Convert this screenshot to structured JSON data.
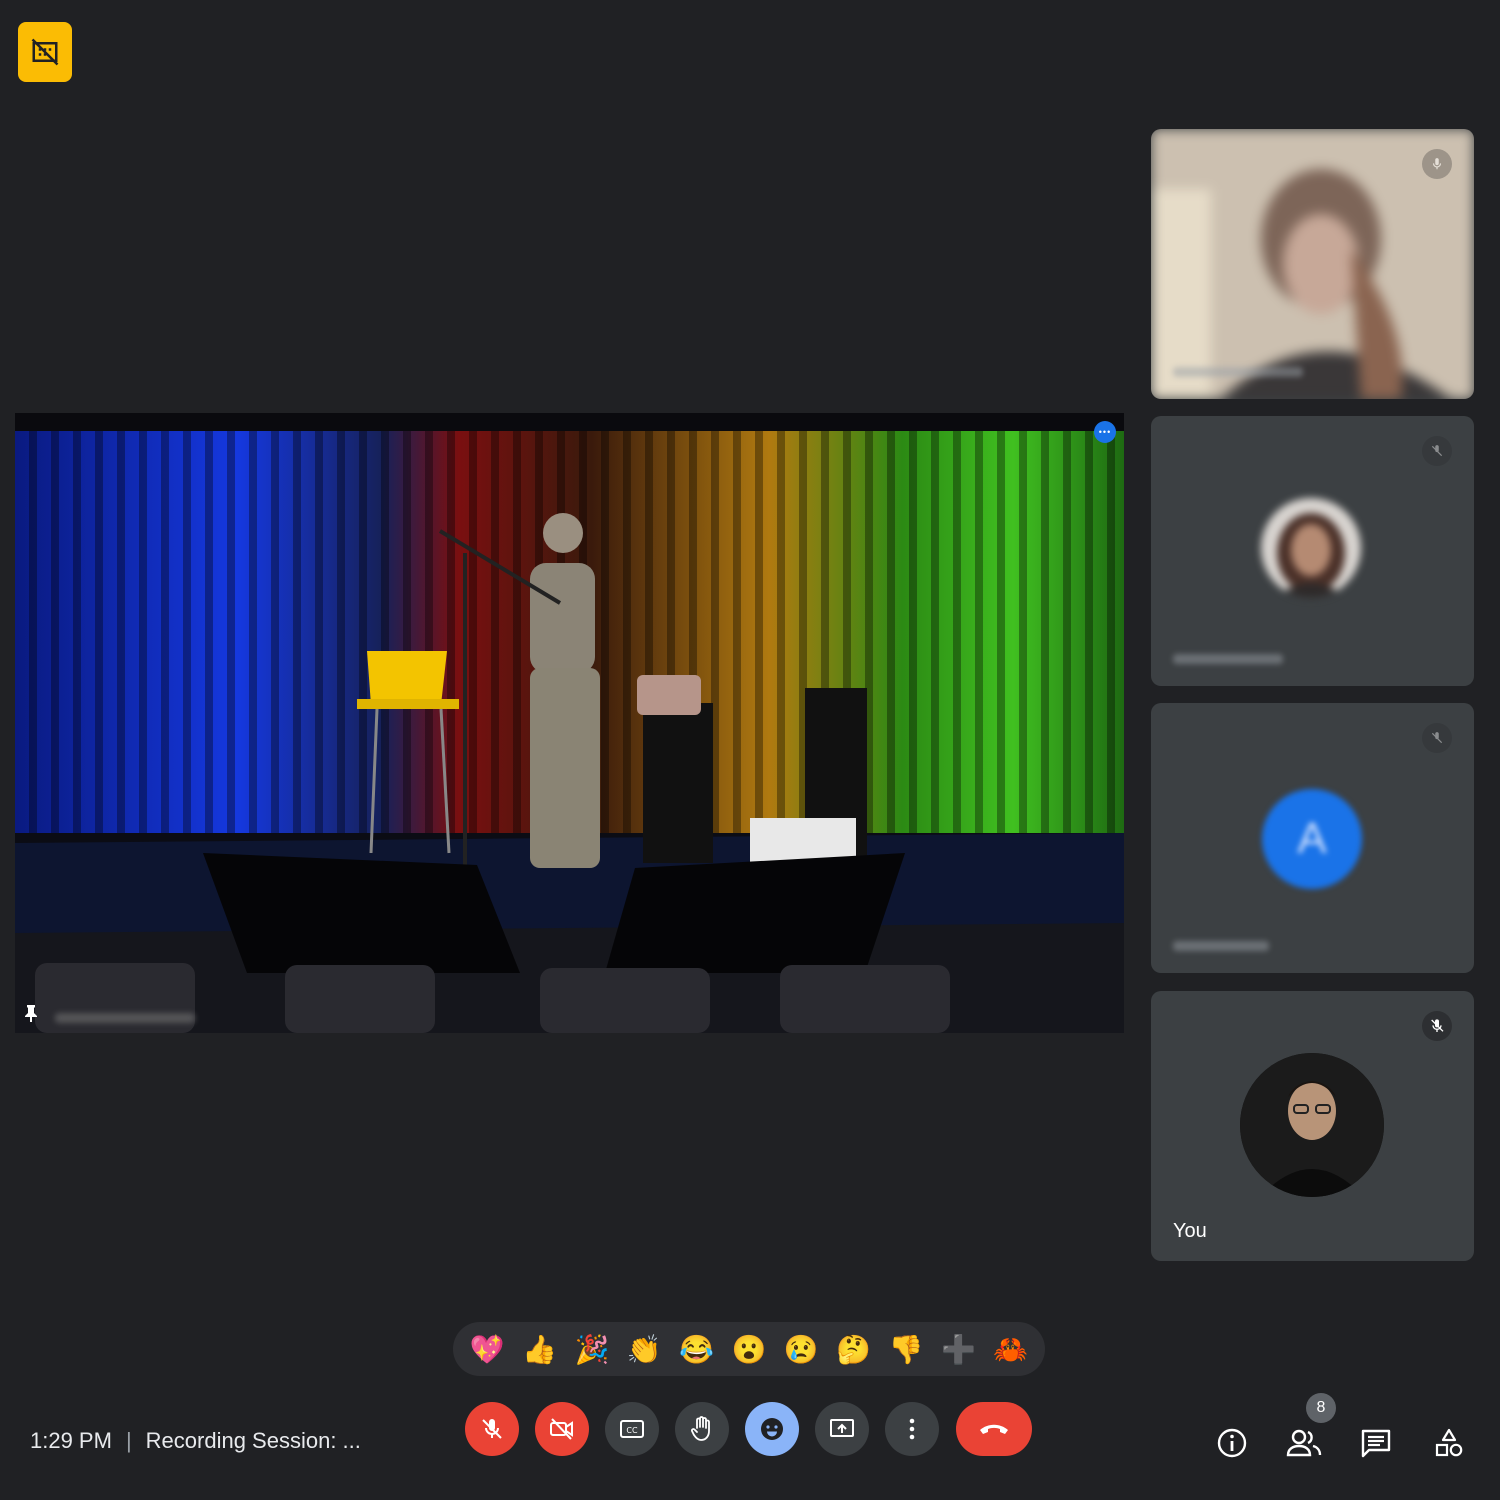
{
  "meeting": {
    "time": "1:29 PM",
    "title": "Recording Session: ..."
  },
  "stage": {
    "speaker_name": "",
    "more_label": "•••"
  },
  "tiles": [
    {
      "kind": "video",
      "name": ""
    },
    {
      "kind": "photo-avatar",
      "name": ""
    },
    {
      "kind": "letter-avatar",
      "initial": "A",
      "name": ""
    },
    {
      "kind": "self",
      "name": "You"
    }
  ],
  "reactions": [
    "💖",
    "👍",
    "🎉",
    "👏",
    "😂",
    "😮",
    "😢",
    "🤔",
    "👎",
    "➕",
    "🦀"
  ],
  "controls": {
    "mic": "mic-off-icon",
    "camera": "videocam-off-icon",
    "captions": "closed-captions-icon",
    "raise_hand": "raise-hand-icon",
    "reactions": "emoji-icon",
    "present": "present-screen-icon",
    "more": "more-vert-icon",
    "leave": "call-end-icon"
  },
  "right_bar": {
    "people_count": "8",
    "icons": [
      "info-icon",
      "people-icon",
      "chat-icon",
      "activities-icon"
    ]
  },
  "colors": {
    "background": "#202124",
    "tile": "#3c4043",
    "danger": "#ea4335",
    "accent": "#8ab4f8",
    "badge": "#fbbc04"
  }
}
